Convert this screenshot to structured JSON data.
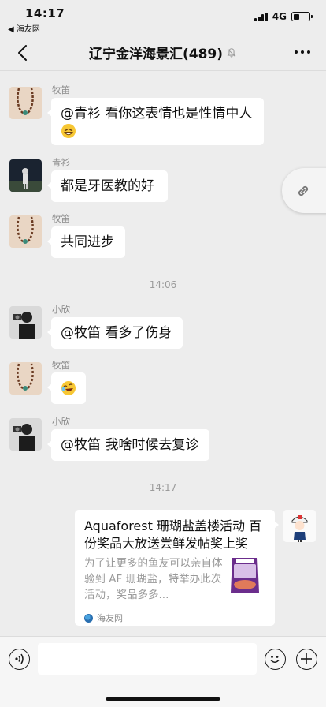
{
  "status_bar": {
    "time": "14:17",
    "back_app": "◀ 海友网",
    "network": "4G"
  },
  "header": {
    "title": "辽宁金洋海景汇(489)"
  },
  "messages": [
    {
      "sender": "牧笛",
      "text": "@青衫 看你这表情也是性情中人",
      "emoji": "grinning-squint-emoji"
    },
    {
      "sender": "青衫",
      "text": "都是牙医教的好"
    },
    {
      "sender": "牧笛",
      "text": "共同进步"
    },
    {
      "sender": "小欣",
      "text": "@牧笛 看多了伤身"
    },
    {
      "sender": "牧笛",
      "emoji": "laughing-tears-emoji"
    },
    {
      "sender": "小欣",
      "text": "@牧笛 我啥时候去复诊"
    }
  ],
  "timestamps": [
    "14:06",
    "14:17"
  ],
  "shared_card": {
    "title": "Aquaforest 珊瑚盐盖楼活动 百份奖品大放送尝鲜发帖奖上奖",
    "description": "为了让更多的鱼友可以亲自体验到 AF 珊瑚盐，特举办此次活动，奖品多多...",
    "source": "海友网"
  },
  "colors": {
    "background": "#ededed",
    "bubble": "#ffffff",
    "meta_text": "#8a8a8a"
  }
}
